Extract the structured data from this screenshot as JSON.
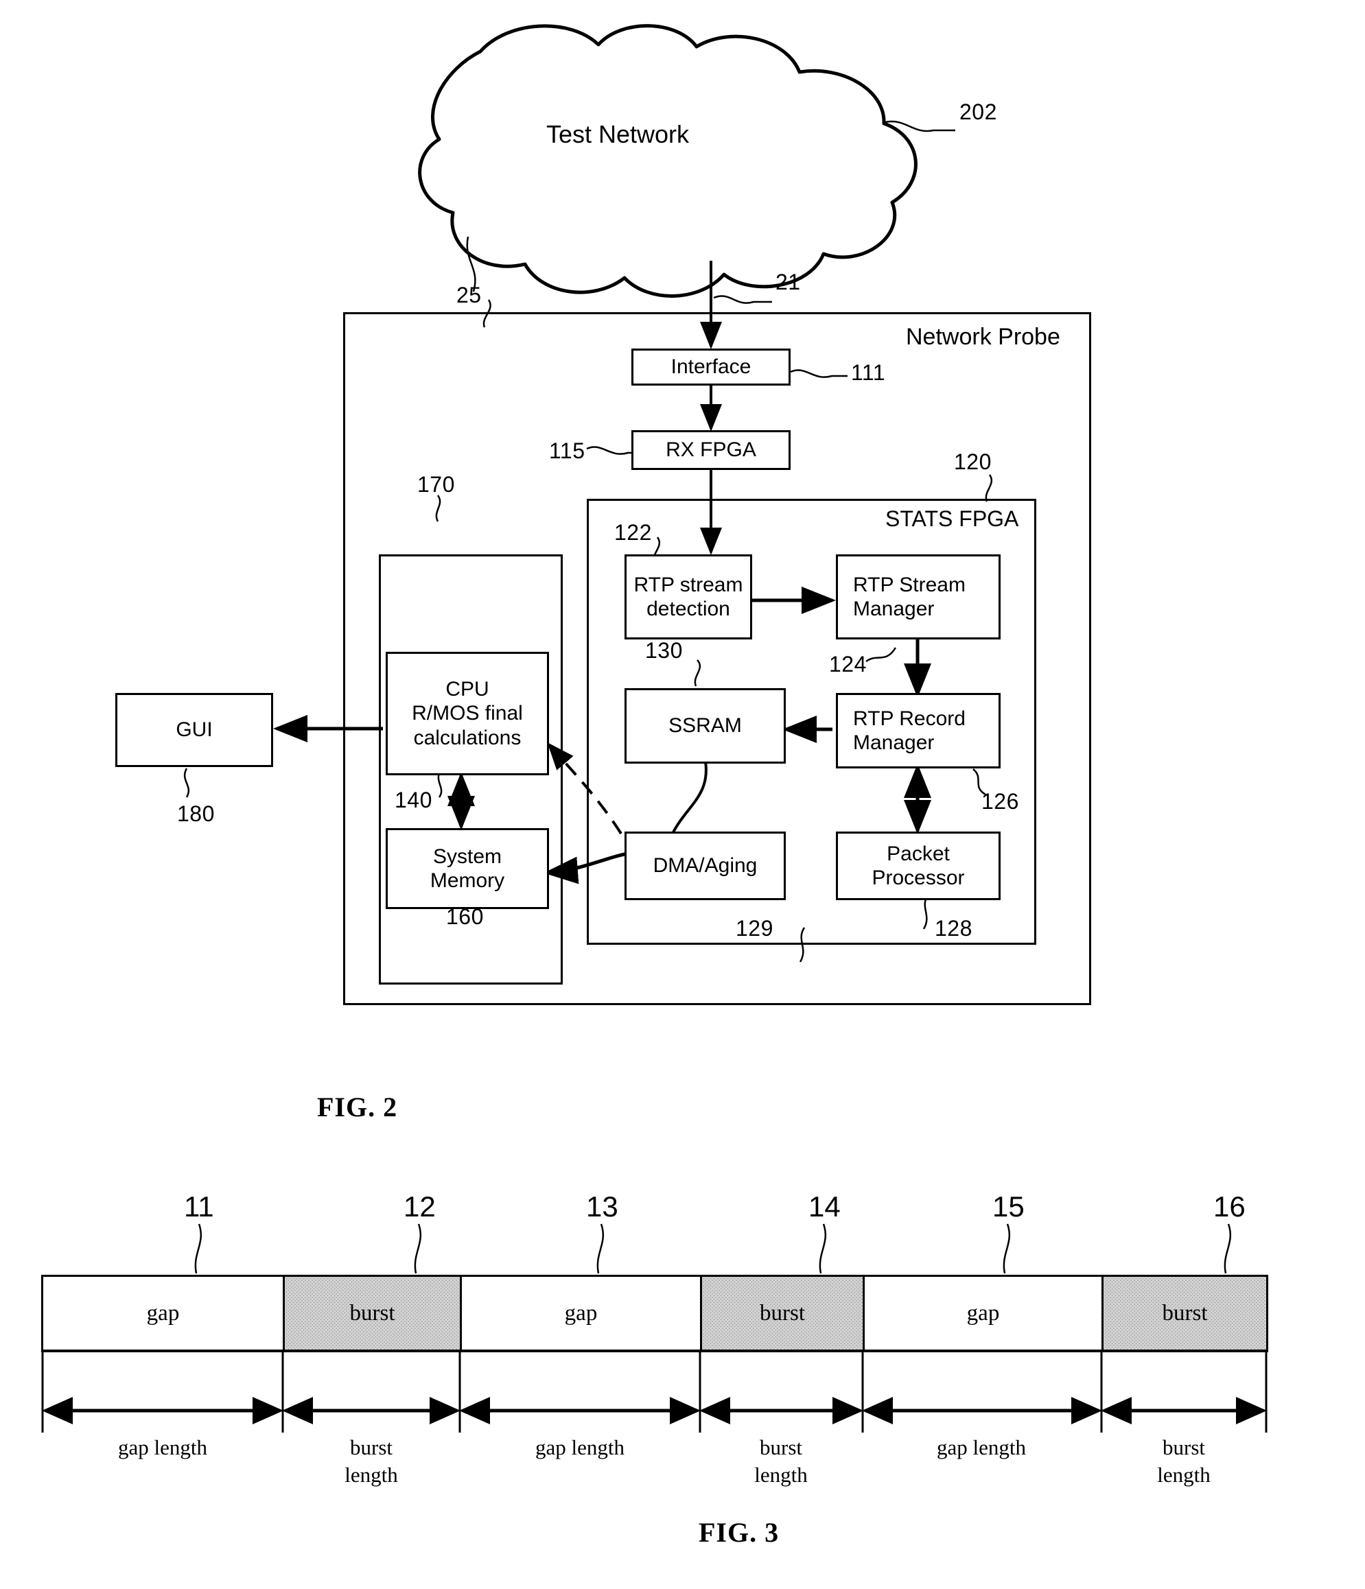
{
  "figures": [
    {
      "id": "fig2",
      "caption": "FIG. 2"
    },
    {
      "id": "fig3",
      "caption": "FIG. 3"
    }
  ],
  "fig2": {
    "caption": "FIG. 2",
    "cloud": {
      "label": "Test Network",
      "ref": "202"
    },
    "link_to_probe_ref": "21",
    "probe": {
      "title": "Network Probe",
      "ref": "25"
    },
    "blocks": {
      "interface": {
        "label": "Interface",
        "ref": "111"
      },
      "rx_fpga": {
        "label": "RX FPGA",
        "ref": "115"
      },
      "stats_fpga": {
        "label": "STATS FPGA",
        "ref": "120"
      },
      "rtp_stream_detection": {
        "label": "RTP stream detection",
        "ref": "122"
      },
      "rtp_stream_manager": {
        "label": "RTP Stream Manager",
        "ref": "124"
      },
      "ssram": {
        "label": "SSRAM",
        "ref": "130"
      },
      "rtp_record_manager": {
        "label": "RTP Record Manager",
        "ref": "126"
      },
      "dma_aging": {
        "label": "DMA/Aging",
        "ref": "129"
      },
      "packet_processor": {
        "label": "Packet Processor",
        "ref": "128"
      },
      "cpu": {
        "label": "CPU R/MOS final calculations",
        "line1": "CPU",
        "line2": "R/MOS final",
        "line3": "calculations",
        "ref": "140"
      },
      "system_memory": {
        "label": "System Memory",
        "line1": "System",
        "line2": "Memory",
        "ref": "160"
      },
      "host_group": {
        "ref": "170"
      },
      "gui": {
        "label": "GUI",
        "ref": "180"
      }
    }
  },
  "fig3": {
    "caption": "FIG. 3",
    "segment_refs": [
      "11",
      "12",
      "13",
      "14",
      "15",
      "16"
    ],
    "segments": [
      {
        "ref": "11",
        "type": "gap",
        "label": "gap",
        "dim_line1": "gap length",
        "dim_line2": ""
      },
      {
        "ref": "12",
        "type": "burst",
        "label": "burst",
        "dim_line1": "burst",
        "dim_line2": "length"
      },
      {
        "ref": "13",
        "type": "gap",
        "label": "gap",
        "dim_line1": "gap length",
        "dim_line2": ""
      },
      {
        "ref": "14",
        "type": "burst",
        "label": "burst",
        "dim_line1": "burst",
        "dim_line2": "length"
      },
      {
        "ref": "15",
        "type": "gap",
        "label": "gap",
        "dim_line1": "gap length",
        "dim_line2": ""
      },
      {
        "ref": "16",
        "type": "burst",
        "label": "burst",
        "dim_line1": "burst",
        "dim_line2": "length"
      }
    ]
  },
  "colors": {
    "ink": "#000000",
    "paper": "#ffffff",
    "burst_fill": "#d4d4d4"
  }
}
